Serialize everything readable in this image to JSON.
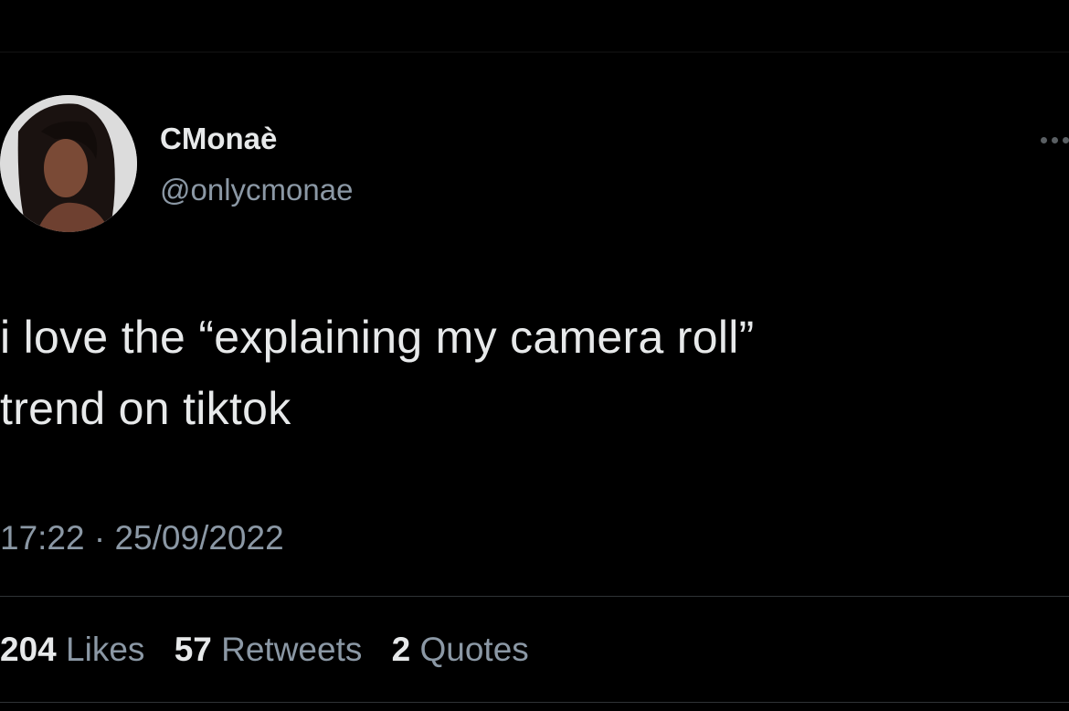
{
  "author": {
    "display_name": "CMonaè",
    "handle": "@onlycmonae"
  },
  "tweet": {
    "lines": [
      "i love the “explaining my camera roll”",
      "trend on tiktok"
    ],
    "time": "17:22",
    "separator": "·",
    "date": "25/09/2022"
  },
  "stats": {
    "likes_count": "204",
    "likes_label": "Likes",
    "retweets_count": "57",
    "retweets_label": "Retweets",
    "quotes_count": "2",
    "quotes_label": "Quotes"
  },
  "icons": {
    "more": "more-horizontal-icon",
    "avatar": "profile-photo"
  },
  "colors": {
    "background": "#000000",
    "primary_text": "#e7e9ea",
    "secondary_text": "#8b98a5",
    "divider": "#2f3336"
  }
}
